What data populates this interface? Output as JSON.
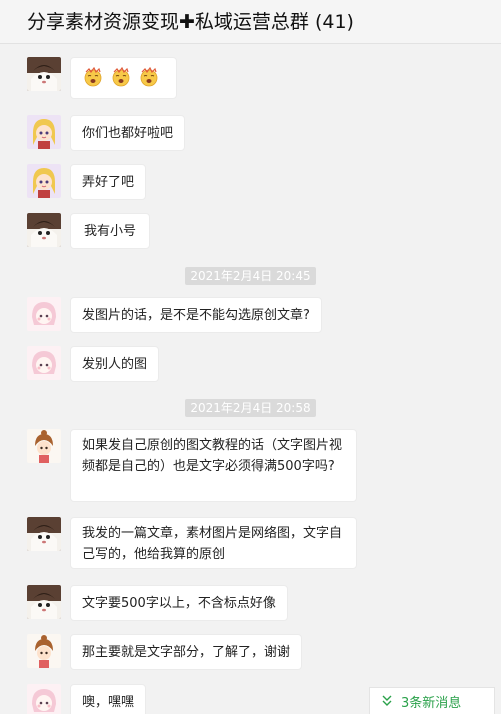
{
  "header": {
    "title": "分享素材资源变现✚私域运营总群 (41)"
  },
  "timestamps": [
    "2021年2月4日 20:45",
    "2021年2月4日 20:58"
  ],
  "messages": [
    {
      "avatar": "cat-avatar",
      "text": ""
    },
    {
      "avatar": "anime-girl-avatar",
      "text": "你们也都好啦吧"
    },
    {
      "avatar": "anime-girl-avatar",
      "text": "弄好了吧"
    },
    {
      "avatar": "cat-avatar",
      "text": "我有小号"
    },
    {
      "avatar": "pink-girl-avatar",
      "text": "发图片的话，是不是不能勾选原创文章?"
    },
    {
      "avatar": "pink-girl-avatar",
      "text": "发别人的图"
    },
    {
      "avatar": "chibi-avatar",
      "text": "如果发自己原创的图文教程的话（文字图片视频都是自己的）也是文字必须得满500字吗?"
    },
    {
      "avatar": "cat-avatar",
      "text": "我发的一篇文章，素材图片是网络图，文字自己写的，他给我算的原创"
    },
    {
      "avatar": "cat-avatar",
      "text": "文字要500字以上，不含标点好像"
    },
    {
      "avatar": "chibi-avatar",
      "text": "那主要就是文字部分，了解了，谢谢"
    },
    {
      "avatar": "pink-girl-avatar",
      "text": "噢，嘿嘿"
    }
  ],
  "emoji_names": [
    "yawn-emoji",
    "yawn-emoji",
    "yawn-emoji"
  ],
  "new_messages": {
    "label": "3条新消息",
    "icon": "double-chevron-down-icon"
  },
  "colors": {
    "background": "#f2f2f2",
    "bubble": "#ffffff",
    "timestamp_bg": "#dadada",
    "accent_green": "#2aa14a"
  }
}
